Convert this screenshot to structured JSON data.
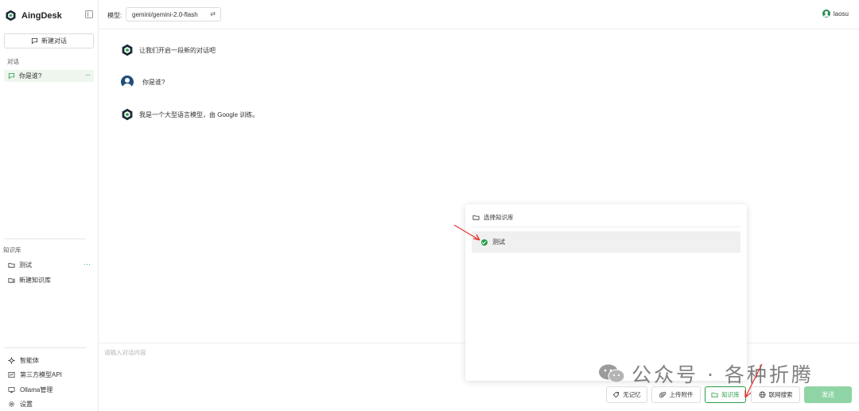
{
  "app": {
    "name": "AingDesk"
  },
  "sidebar": {
    "new_chat_label": "新建对话",
    "conversations_label": "对话",
    "conversations": [
      {
        "title": "你是谁?",
        "more": "···"
      }
    ],
    "knowledge_label": "知识库",
    "knowledge_items": [
      {
        "label": "测试",
        "more": "···"
      },
      {
        "label": "新建知识库"
      }
    ],
    "bottom_items": [
      {
        "label": "智能体",
        "icon": "sparkle-icon"
      },
      {
        "label": "第三方模型API",
        "icon": "api-icon"
      },
      {
        "label": "Ollama管理",
        "icon": "monitor-icon"
      },
      {
        "label": "设置",
        "icon": "gear-icon"
      }
    ]
  },
  "topbar": {
    "model_label": "模型:",
    "model_value": "gemini/gemini-2.0-flash",
    "swap_glyph": "⇄",
    "username": "laosu"
  },
  "messages": [
    {
      "role": "assistant",
      "text": "让我们开启一段新的对话吧"
    },
    {
      "role": "user",
      "text": "你是谁?"
    },
    {
      "role": "assistant",
      "text": "我是一个大型语言模型，由 Google 训练。"
    }
  ],
  "input": {
    "placeholder": "请输入对话内容",
    "buttons": {
      "no_memory": "无记忆",
      "upload": "上传附件",
      "knowledge": "知识库",
      "web_search": "联网搜索",
      "send": "发送"
    }
  },
  "knowledge_popup": {
    "title": "选择知识库",
    "items": [
      {
        "label": "测试",
        "selected": true
      }
    ]
  },
  "watermark": {
    "text": "公众号 · 各种折腾"
  },
  "colors": {
    "accent": "#2a9d4a",
    "send_disabled": "#8fd4a5",
    "annotation_arrow": "#e53935"
  }
}
